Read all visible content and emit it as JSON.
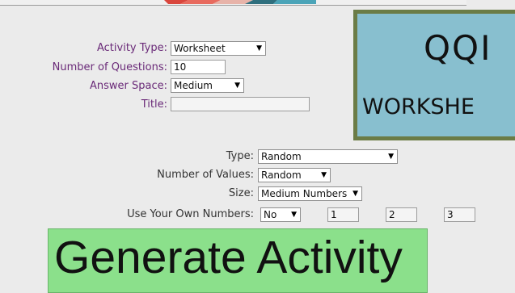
{
  "activity": {
    "type_label": "Activity Type:",
    "type_value": "Worksheet",
    "questions_label": "Number of Questions:",
    "questions_value": "10",
    "answer_space_label": "Answer Space:",
    "answer_space_value": "Medium",
    "title_label": "Title:",
    "title_value": ""
  },
  "preview": {
    "title": "QQI",
    "subtitle": "WORKSHE"
  },
  "options": {
    "type_label": "Type:",
    "type_value": "Random",
    "num_values_label": "Number of Values:",
    "num_values_value": "Random",
    "size_label": "Size:",
    "size_value": "Medium Numbers",
    "own_numbers_label": "Use Your Own Numbers:",
    "own_numbers_value": "No",
    "own_number_1": "1",
    "own_number_2": "2",
    "own_number_3": "3"
  },
  "generate_label": "Generate Activity",
  "icons": {
    "dropdown": "chevron-down-icon"
  },
  "colors": {
    "label_purple": "#6a2a78",
    "preview_bg": "#88bfcf",
    "preview_border": "#6b7c46",
    "generate_bg": "#8be08b"
  }
}
